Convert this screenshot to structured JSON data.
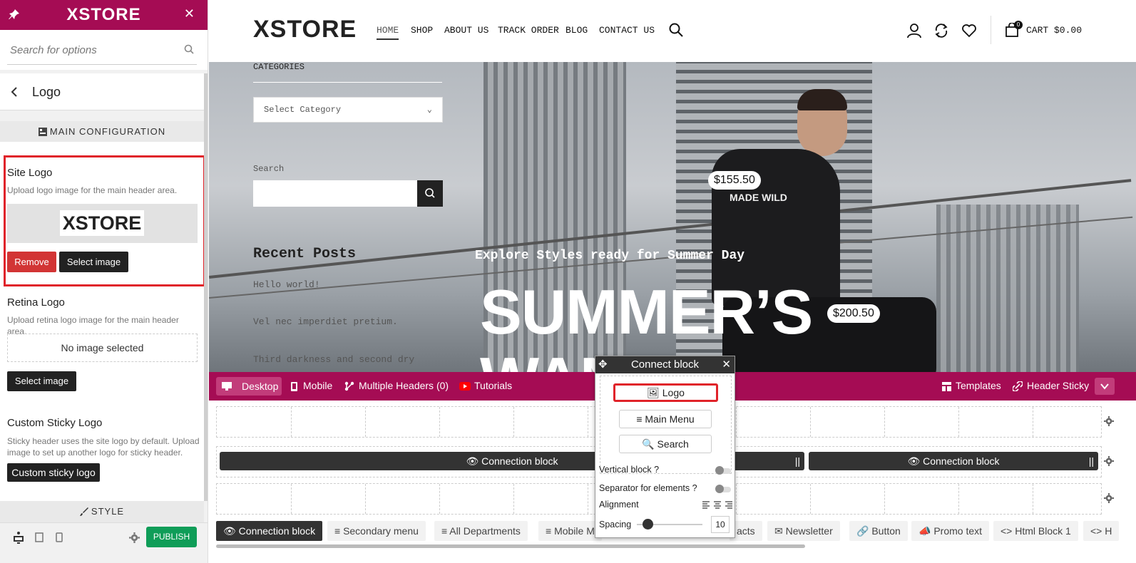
{
  "panel": {
    "brand": "XSTORE",
    "search_placeholder": "Search for options",
    "back_title": "Logo",
    "section_main": "MAIN CONFIGURATION",
    "site_logo": {
      "title": "Site Logo",
      "desc": "Upload logo image for the main header area.",
      "preview_text": "XSTORE",
      "remove": "Remove",
      "select": "Select image"
    },
    "retina_logo": {
      "title": "Retina Logo",
      "desc": "Upload retina logo image for the main header area.",
      "empty": "No image selected",
      "select": "Select image"
    },
    "sticky_logo": {
      "title": "Custom Sticky Logo",
      "desc": "Sticky header uses the site logo by default. Upload image to set up another logo for sticky header.",
      "button": "Custom sticky logo"
    },
    "section_style": "STYLE",
    "publish": "PUBLISH"
  },
  "site": {
    "logo": "XSTORE",
    "nav": [
      "HOME",
      "SHOP",
      "ABOUT US",
      "TRACK ORDER",
      "BLOG",
      "CONTACT US"
    ],
    "cart_label": "CART $0.00",
    "cart_count": "0",
    "categories_title": "CATEGORIES",
    "category_select": "Select Category",
    "search_label": "Search",
    "recent_posts_title": "Recent Posts",
    "recent_posts": [
      "Hello world!",
      "Vel nec imperdiet pretium.",
      "Third darkness and second dry"
    ],
    "hero_subtitle": "Explore Styles ready for Summer Day",
    "hero_title": "SUMMER’S",
    "hero_title2": "WAN",
    "price_1": "$155.50",
    "price_2": "$200.50",
    "tshirt_text": "MADE WILD"
  },
  "builder": {
    "desktop": "Desktop",
    "mobile": "Mobile",
    "multiple_headers": "Multiple Headers (0)",
    "tutorials": "Tutorials",
    "templates": "Templates",
    "header_sticky": "Header Sticky",
    "connection_block": "Connection block",
    "elements": [
      "Connection block",
      "Secondary menu",
      "All Departments",
      "Mobile M",
      "acts",
      "Newsletter",
      "Button",
      "Promo text",
      "Html Block 1",
      "H"
    ]
  },
  "popup": {
    "title": "Connect block",
    "items": [
      "Logo",
      "Main Menu",
      "Search"
    ],
    "vertical": "Vertical block ?",
    "separator": "Separator for elements ?",
    "alignment": "Alignment",
    "spacing": "Spacing",
    "spacing_value": "10"
  },
  "colors": {
    "accent": "#a50c54",
    "highlight": "#e0232a",
    "publish": "#0f9d58"
  }
}
